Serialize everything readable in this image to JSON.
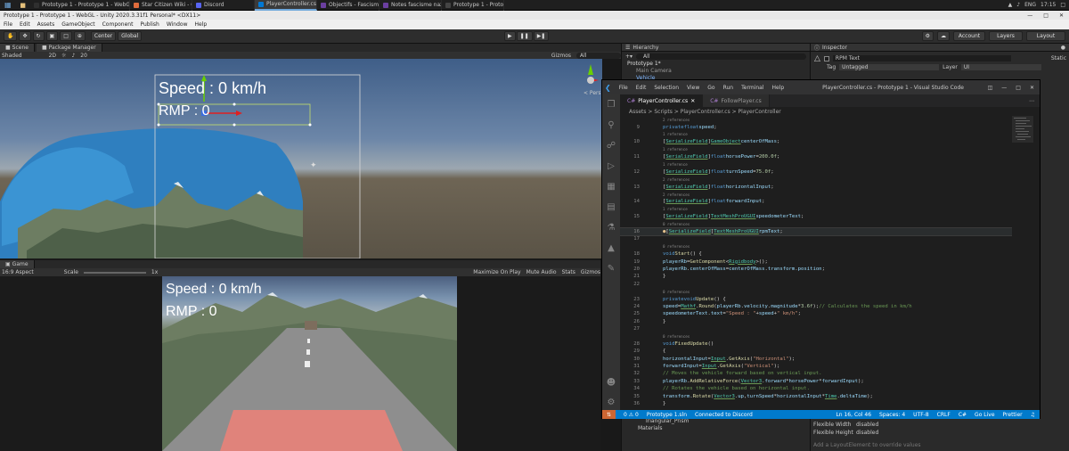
{
  "taskbar": {
    "tasks": [
      {
        "label": "Prototype 1 - Prototype 1 - WebGL - Unity 2020.3.31f1 Personal* <DX11>",
        "color": "#2f2f2f",
        "active": false
      },
      {
        "label": "Star Citizen Wiki - Op...",
        "color": "#e06c3c",
        "active": false
      },
      {
        "label": "Discord",
        "color": "#5865f2",
        "active": false
      },
      {
        "label": "PlayerController.cs",
        "color": "#0078d4",
        "active": true
      },
      {
        "label": "Objectifs - Fascisme...",
        "color": "#6b3fa0",
        "active": false
      },
      {
        "label": "Notes fascisme nazis...",
        "color": "#6b3fa0",
        "active": false
      },
      {
        "label": "Prototype 1 - Protot...",
        "color": "#444444",
        "active": false
      }
    ],
    "lang": "ENG",
    "clock": "17:15"
  },
  "unity": {
    "title": "Prototype 1 - Prototype 1 - WebGL - Unity 2020.3.31f1 Personal* <DX11>",
    "menu": [
      "File",
      "Edit",
      "Assets",
      "GameObject",
      "Component",
      "Publish",
      "Window",
      "Help"
    ],
    "toolbar": {
      "center": "Center",
      "global": "Global",
      "account": "Account",
      "layers": "Layers",
      "layout": "Layout"
    },
    "scene_tabs": [
      "Scene",
      "Package Manager"
    ],
    "scene_bar": {
      "shading": "Shaded",
      "size": "20",
      "gizmos": "Gizmos",
      "search": "All"
    },
    "scene_ui": {
      "speed": "Speed : 0 km/h",
      "rpm": "RMP : 0"
    },
    "game_tab": "Game",
    "game_bar": {
      "aspect": "16:9 Aspect",
      "scale_label": "Scale",
      "scale": "1x",
      "maximize": "Maximize On Play",
      "mute": "Mute Audio",
      "stats": "Stats",
      "gizmos": "Gizmos"
    },
    "game_ui": {
      "speed": "Speed : 0 km/h",
      "rpm": "RMP : 0"
    },
    "hierarchy": {
      "title": "Hierarchy",
      "search": "All",
      "items": [
        "Prototype 1*",
        "Main Camera",
        "Vehicle"
      ],
      "bottom_items": [
        "Triangular_Prism",
        "Materials"
      ]
    },
    "inspector": {
      "title": "Inspector",
      "object_name": "RPM Text",
      "static": "Static",
      "tag_label": "Tag",
      "tag": "Untagged",
      "layer_label": "Layer",
      "layer": "UI",
      "flex_width_label": "Flexible Width",
      "flex_width": "disabled",
      "flex_height_label": "Flexible Height",
      "flex_height": "disabled",
      "footer": "Add a LayoutElement to override values"
    }
  },
  "vscode": {
    "menu": [
      "File",
      "Edit",
      "Selection",
      "View",
      "Go",
      "Run",
      "Terminal",
      "Help"
    ],
    "title": "PlayerController.cs - Prototype 1 - Visual Studio Code",
    "tabs": [
      {
        "label": "PlayerController.cs",
        "active": true
      },
      {
        "label": "FollowPlayer.cs",
        "active": false
      }
    ],
    "breadcrumb": "Assets > Scripts > PlayerController.cs > PlayerController",
    "status": {
      "branch": "Prototype 1.sln",
      "problems": "0 ⚠ 0",
      "discord": "Connected to Discord",
      "position": "Ln 16, Col 46",
      "spaces": "Spaces: 4",
      "encoding": "UTF-8",
      "eol": "CRLF",
      "lang": "C#",
      "golive": "Go Live",
      "prettier": "Prettier"
    }
  }
}
